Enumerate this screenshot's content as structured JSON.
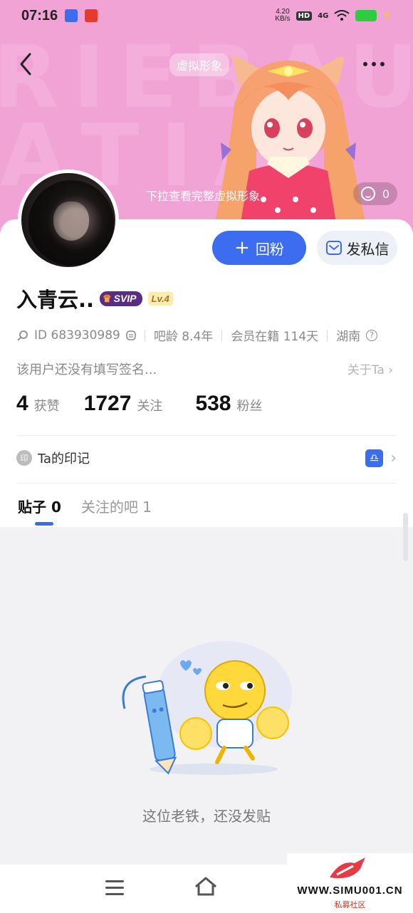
{
  "status_bar": {
    "time": "07:16",
    "net_speed": "4.20",
    "net_unit": "KB/s",
    "hd": "HD",
    "signal": "4G"
  },
  "header": {
    "avatar_tag": "虚拟形象",
    "pull_hint": "下拉查看完整虚拟形象",
    "like_count": "0"
  },
  "actions": {
    "follow_back": "回粉",
    "message": "发私信"
  },
  "profile": {
    "username": "入青云..",
    "svip": "SVIP",
    "level": "Lv.4",
    "id": "ID 683930989",
    "age": "吧龄 8.4年",
    "membership": "会员在籍 114天",
    "location": "湖南",
    "bio": "该用户还没有填写签名...",
    "about": "关于Ta"
  },
  "stats": [
    {
      "value": "4",
      "label": "获赞"
    },
    {
      "value": "1727",
      "label": "关注"
    },
    {
      "value": "538",
      "label": "粉丝"
    }
  ],
  "seal": {
    "icon_text": "印",
    "label": "Ta的印记"
  },
  "tabs": [
    {
      "label": "贴子 0",
      "active": true
    },
    {
      "label": "关注的吧 1",
      "active": false
    }
  ],
  "empty_state": {
    "message": "这位老铁，还没发贴"
  },
  "watermark": {
    "site": "WWW.SIMU001.CN",
    "sub": "私募社区"
  },
  "colors": {
    "banner": "#f2a3d6",
    "accent": "#3c6df0",
    "svip": "#5a2d82"
  }
}
